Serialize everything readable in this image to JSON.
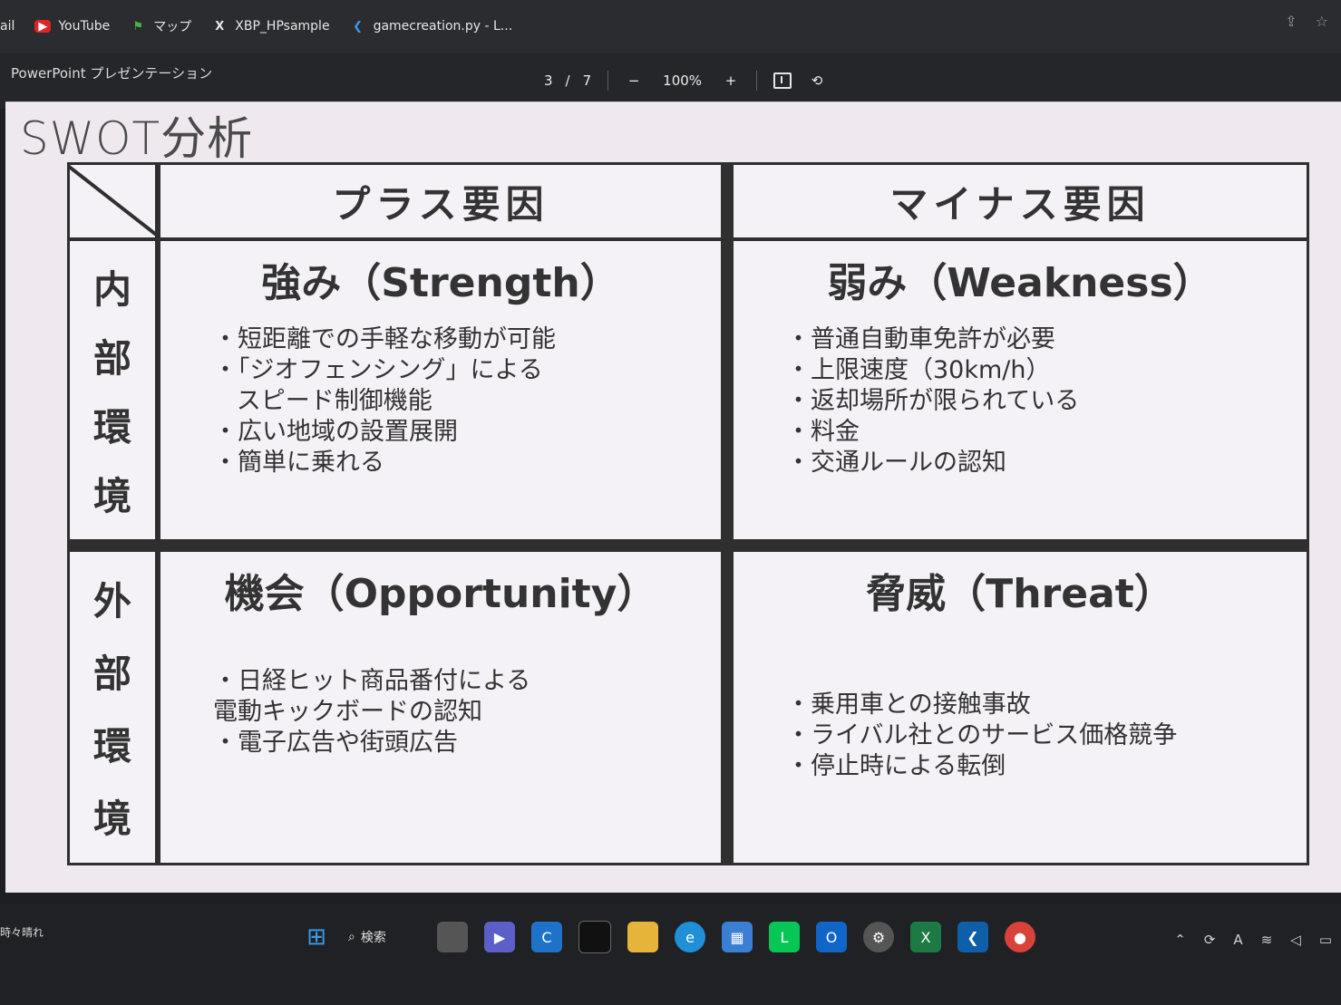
{
  "bookmarks": [
    {
      "label": "ail",
      "icon": "mail-icon"
    },
    {
      "label": "YouTube",
      "icon": "youtube-icon"
    },
    {
      "label": "マップ",
      "icon": "maps-icon"
    },
    {
      "label": "XBP_HPsample",
      "icon": "x-icon"
    },
    {
      "label": "gamecreation.py - L...",
      "icon": "vscode-icon"
    }
  ],
  "viewer": {
    "title": "PowerPoint プレゼンテーション",
    "page_current": "3",
    "page_sep": "/",
    "page_total": "7",
    "zoom_out": "−",
    "zoom": "100%",
    "zoom_in": "+"
  },
  "slide": {
    "title": "SWOT分析",
    "col_plus": "プラス要因",
    "col_minus": "マイナス要因",
    "row_internal": [
      "内",
      "部",
      "環",
      "境"
    ],
    "row_external": [
      "外",
      "部",
      "環",
      "境"
    ],
    "strength": {
      "title": "強み（Strength）",
      "items": [
        "短距離での手軽な移動が可能",
        "「ジオフェンシング」による\n   スピード制御機能",
        "広い地域の設置展開",
        "簡単に乗れる"
      ]
    },
    "weakness": {
      "title": "弱み（Weakness）",
      "items": [
        "普通自動車免許が必要",
        "上限速度（30km/h）",
        "返却場所が限られている",
        "料金",
        "交通ルールの認知"
      ]
    },
    "opportunity": {
      "title": "機会（Opportunity）",
      "items": [
        "日経ヒット商品番付による\n電動キックボードの認知",
        "電子広告や街頭広告"
      ]
    },
    "threat": {
      "title": "脅威（Threat）",
      "items": [
        "乗用車との接触事故",
        "ライバル社とのサービス価格競争",
        "停止時による転倒"
      ]
    }
  },
  "taskbar": {
    "weather": "時々晴れ",
    "search": "検索"
  }
}
